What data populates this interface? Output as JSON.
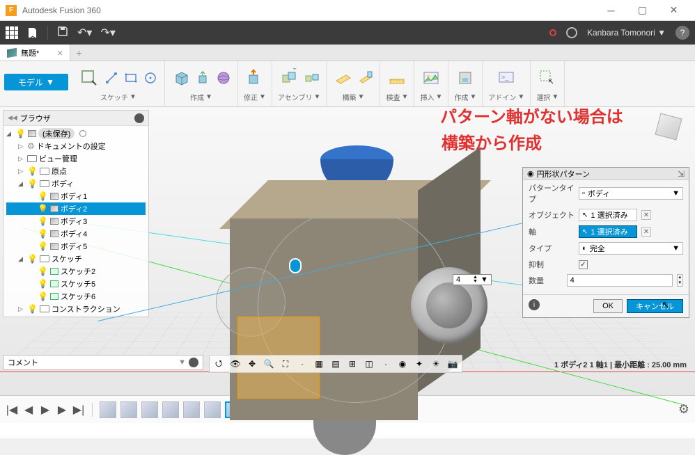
{
  "app": {
    "title": "Autodesk Fusion 360"
  },
  "user": {
    "name": "Kanbara Tomonori"
  },
  "document": {
    "tab_title": "無題*"
  },
  "workspace": {
    "label": "モデル"
  },
  "ribbon": {
    "groups": [
      {
        "label": "スケッチ"
      },
      {
        "label": "作成"
      },
      {
        "label": "修正"
      },
      {
        "label": "アセンブリ"
      },
      {
        "label": "構築"
      },
      {
        "label": "検査"
      },
      {
        "label": "挿入"
      },
      {
        "label": "作成"
      },
      {
        "label": "アドイン"
      },
      {
        "label": "選択"
      }
    ]
  },
  "browser": {
    "title": "ブラウザ",
    "root": "(未保存)",
    "doc_settings": "ドキュメントの設定",
    "views": "ビュー管理",
    "origin": "原点",
    "bodies_folder": "ボディ",
    "bodies": [
      "ボディ1",
      "ボディ2",
      "ボディ3",
      "ボディ4",
      "ボディ5"
    ],
    "sketch_folder": "スケッチ",
    "sketches": [
      "スケッチ2",
      "スケッチ5",
      "スケッチ6"
    ],
    "construction": "コンストラクション"
  },
  "annotations": {
    "line1": "パターン軸がない場合は",
    "line2": "構築から作成"
  },
  "viewport": {
    "qty_value": "4"
  },
  "panel": {
    "title": "円形状パターン",
    "pattern_type_label": "パターンタイプ",
    "pattern_type_value": "ボディ",
    "objects_label": "オブジェクト",
    "selected_text": "1 選択済み",
    "axis_label": "軸",
    "type_label": "タイプ",
    "type_value": "完全",
    "suppress_label": "抑制",
    "qty_label": "数量",
    "qty_value": "4",
    "ok": "OK",
    "cancel": "キャンセル"
  },
  "comment_bar": {
    "label": "コメント"
  },
  "status": {
    "text": "1 ボディ2 1 軸1 | 最小距離 : 25.00 mm"
  }
}
